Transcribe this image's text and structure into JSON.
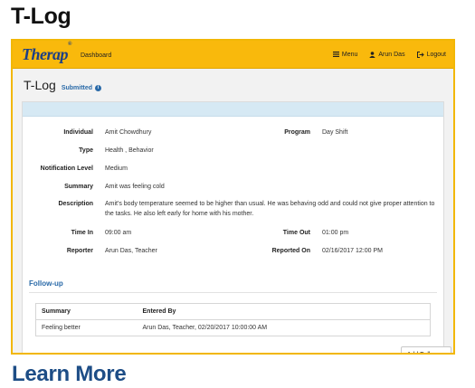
{
  "heading": "T-Log",
  "navbar": {
    "logo_text": "Therap",
    "logo_mark": "®",
    "dashboard": "Dashboard",
    "menu": "Menu",
    "user": "Arun Das",
    "logout": "Logout",
    "bg_color": "#f9b90c",
    "logo_color": "#1c3f86"
  },
  "page": {
    "title": "T-Log",
    "status": "Submitted"
  },
  "details": {
    "individual_label": "Individual",
    "individual": "Amit Chowdhury",
    "program_label": "Program",
    "program": "Day Shift",
    "type_label": "Type",
    "type": "Health , Behavior",
    "notification_label": "Notification Level",
    "notification": "Medium",
    "summary_label": "Summary",
    "summary": "Amit was feeling cold",
    "description_label": "Description",
    "description": "Amit's body temperature seemed to be higher than usual. He was behaving odd and could not give proper attention to the tasks. He also left early for home with his mother.",
    "time_in_label": "Time In",
    "time_in": "09:00 am",
    "time_out_label": "Time Out",
    "time_out": "01:00 pm",
    "reporter_label": "Reporter",
    "reporter": "Arun Das, Teacher",
    "reported_on_label": "Reported On",
    "reported_on": "02/16/2017 12:00 PM"
  },
  "followup": {
    "title": "Follow-up",
    "columns": [
      "Summary",
      "Entered By"
    ],
    "rows": [
      [
        "Feeling better",
        "Arun Das, Teacher, 02/20/2017 10:00:00 AM"
      ]
    ],
    "add_button": "Add Followup"
  },
  "footer_link": "Learn More",
  "colors": {
    "accent_border": "#f2b705",
    "link_blue": "#2a6aa8",
    "learn_more": "#1d4d86"
  }
}
